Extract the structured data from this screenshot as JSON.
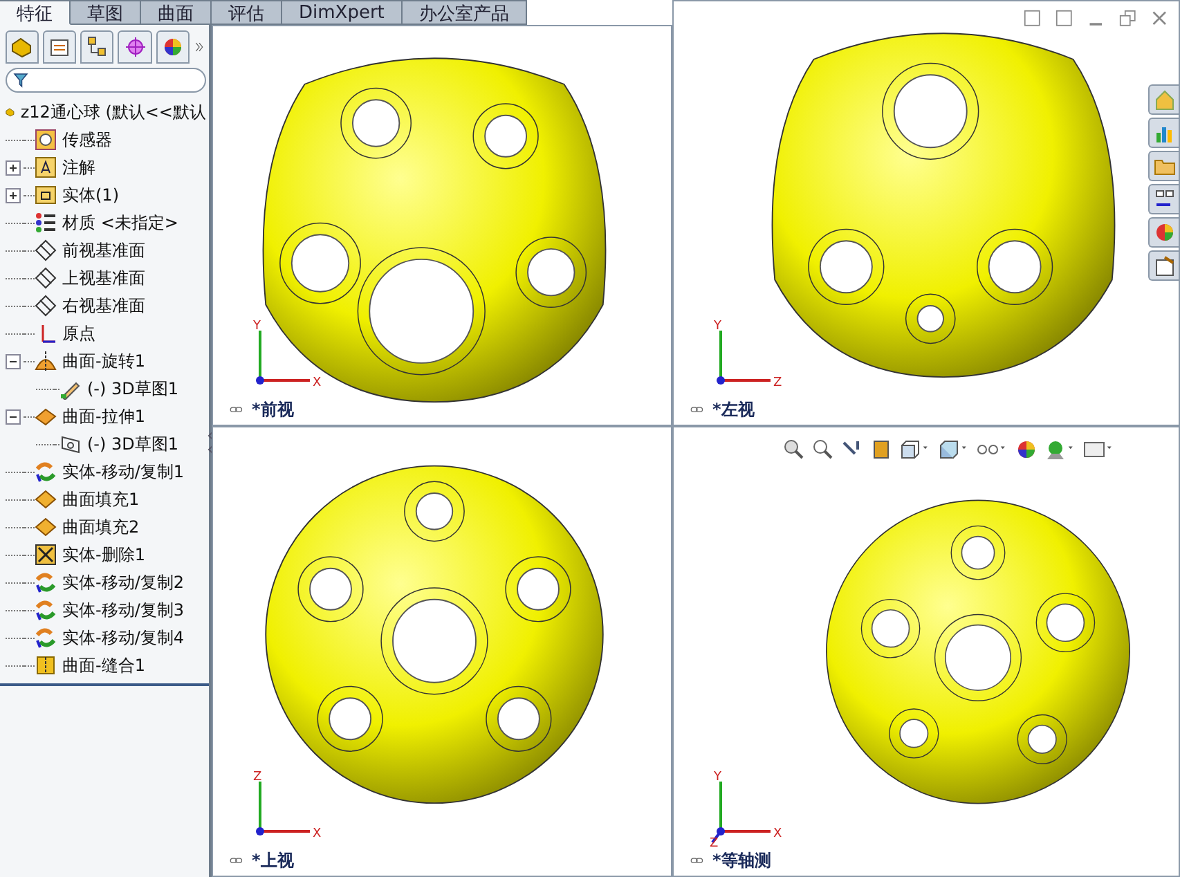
{
  "command_tabs": [
    {
      "label": "特征",
      "selected": true
    },
    {
      "label": "草图",
      "selected": false
    },
    {
      "label": "曲面",
      "selected": false
    },
    {
      "label": "评估",
      "selected": false
    },
    {
      "label": "DimXpert",
      "selected": false
    },
    {
      "label": "办公室产品",
      "selected": false
    }
  ],
  "feature_tree": {
    "root": "z12通心球 (默认<<默认",
    "items": [
      {
        "kind": "sensor",
        "label": "传感器"
      },
      {
        "kind": "annotation",
        "label": "注解",
        "expanded": false
      },
      {
        "kind": "body",
        "label": "实体(1)",
        "expanded": false
      },
      {
        "kind": "material",
        "label": "材质 <未指定>"
      },
      {
        "kind": "plane",
        "label": "前视基准面"
      },
      {
        "kind": "plane",
        "label": "上视基准面"
      },
      {
        "kind": "plane",
        "label": "右视基准面"
      },
      {
        "kind": "origin",
        "label": "原点"
      },
      {
        "kind": "revolve",
        "label": "曲面-旋转1",
        "expanded": true,
        "children": [
          {
            "kind": "sketch",
            "label": "(-) 3D草图1"
          }
        ]
      },
      {
        "kind": "extrude",
        "label": "曲面-拉伸1",
        "expanded": true,
        "children": [
          {
            "kind": "sketch2",
            "label": "(-) 3D草图1"
          }
        ]
      },
      {
        "kind": "move",
        "label": "实体-移动/复制1"
      },
      {
        "kind": "fill",
        "label": "曲面填充1"
      },
      {
        "kind": "fill",
        "label": "曲面填充2"
      },
      {
        "kind": "delete",
        "label": "实体-删除1"
      },
      {
        "kind": "move",
        "label": "实体-移动/复制2"
      },
      {
        "kind": "move",
        "label": "实体-移动/复制3"
      },
      {
        "kind": "move",
        "label": "实体-移动/复制4"
      },
      {
        "kind": "knit",
        "label": "曲面-缝合1"
      }
    ]
  },
  "viewports": [
    {
      "label": "*前视",
      "axes": [
        "Y",
        "X"
      ]
    },
    {
      "label": "*左视",
      "axes": [
        "Y",
        "Z"
      ]
    },
    {
      "label": "*上视",
      "axes": [
        "Z",
        "X"
      ]
    },
    {
      "label": "*等轴测",
      "axes": [
        "Y",
        "X",
        "Z"
      ]
    }
  ]
}
